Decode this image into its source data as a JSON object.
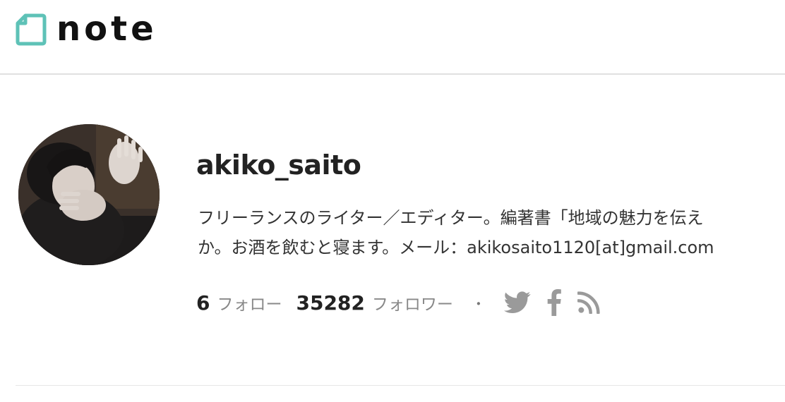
{
  "header": {
    "logo_text": "note",
    "logo_color": "#5ec2b7"
  },
  "profile": {
    "username": "akiko_saito",
    "bio_lines": [
      "フリーランスのライター／エディター。編著書「地域の魅力を伝え",
      "か。お酒を飲むと寝ます。メール：akikosaito1120[at]gmail.com"
    ]
  },
  "stats": {
    "follow_count": "6",
    "follow_label": "フォロー",
    "follower_count": "35282",
    "follower_label": "フォロワー",
    "separator": "・"
  },
  "social": {
    "icons": [
      "twitter-icon",
      "facebook-icon",
      "rss-icon"
    ],
    "icon_color": "#9a9a9a"
  }
}
